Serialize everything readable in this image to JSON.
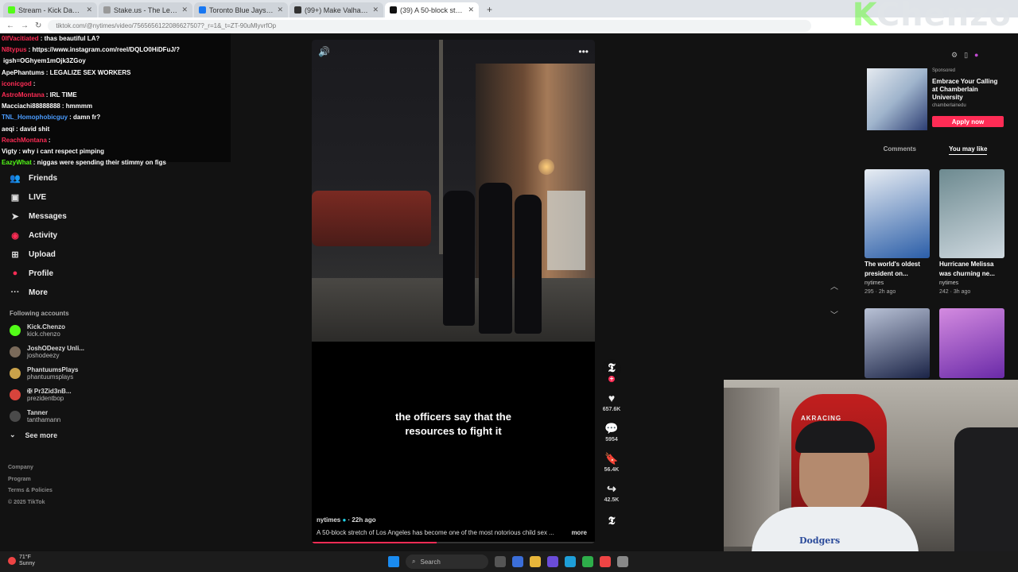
{
  "browser": {
    "tabs": [
      {
        "label": "Stream - Kick Dashboard",
        "fav_color": "#53fc18"
      },
      {
        "label": "Stake.us - The Leading Social C",
        "fav_color": "#999999"
      },
      {
        "label": "Toronto Blue Jays at Los Angeles",
        "fav_color": "#1877f2"
      },
      {
        "label": "(99+) Make Valhalla Great Again",
        "fav_color": "#333333"
      },
      {
        "label": "(39) A 50-block stretch of",
        "fav_color": "#111111",
        "active": true
      }
    ],
    "new_tab": "+",
    "url": "tiktok.com/@nytimes/video/7565656122086627507?_r=1&_t=ZT-90uMlyvrfOp",
    "logo_k": "K",
    "logo_text": "Chenzo"
  },
  "chat": [
    {
      "user": "0lfVacitiated",
      "color": "#fe2c55",
      "text": ": thas beautiful LA?"
    },
    {
      "user": "N8typus",
      "color": "#fe2c55",
      "text": ": https://www.instagram.com/reel/DQLO0HiDFuJ/?"
    },
    {
      "user": "",
      "color": "#ffffff",
      "text": "igsh=OGhyem1mOjk3ZGoy"
    },
    {
      "user": "ApePhantums",
      "color": "#ffffff",
      "text": ": LEGALIZE SEX WORKERS"
    },
    {
      "user": "iconicgod",
      "color": "#fe2c55",
      "text": ":"
    },
    {
      "user": "AstroMontana",
      "color": "#fe2c55",
      "text": ": IRL TIME"
    },
    {
      "user": "Macciachi88888888",
      "color": "#ffffff",
      "text": ": hmmmm"
    },
    {
      "user": "TNL_Homophobicguy",
      "color": "#4a9cff",
      "text": ": damn fr?"
    },
    {
      "user": "aeqi",
      "color": "#ffffff",
      "text": ": david shit"
    },
    {
      "user": "ReachMontana",
      "color": "#fe2c55",
      "text": ":"
    },
    {
      "user": "Vigty",
      "color": "#ffffff",
      "text": ": why i cant respect pimping"
    },
    {
      "user": "EazyWhat",
      "color": "#53fc18",
      "text": ": niggas were spending their stimmy on figs"
    }
  ],
  "sidebar": {
    "items": [
      {
        "label": "Friends",
        "icon": "users-icon",
        "glyph": "👥"
      },
      {
        "label": "LIVE",
        "icon": "live-icon",
        "glyph": "▣"
      },
      {
        "label": "Messages",
        "icon": "messages-icon",
        "glyph": "➤"
      },
      {
        "label": "Activity",
        "icon": "activity-icon",
        "glyph": "◉"
      },
      {
        "label": "Upload",
        "icon": "upload-icon",
        "glyph": "⊞"
      },
      {
        "label": "Profile",
        "icon": "profile-icon",
        "glyph": "●"
      },
      {
        "label": "More",
        "icon": "more-icon",
        "glyph": "···"
      }
    ],
    "following_title": "Following accounts",
    "accounts": [
      {
        "name": "Kick.Chenzo",
        "handle": "kick.chenzo"
      },
      {
        "name": "JoshODeezy Unli...",
        "handle": "joshodeezy"
      },
      {
        "name": "PhantuumsPlays",
        "handle": "phantuumsplays"
      },
      {
        "name": "✠ Pr3Zid3nB...",
        "handle": "prezidentbop"
      },
      {
        "name": "Tanner",
        "handle": "tanthamann"
      }
    ],
    "see_more": "See more",
    "footer": [
      "Company",
      "Program",
      "Terms & Policies",
      "© 2025 TikTok"
    ]
  },
  "video": {
    "caption": "the officers say that the resources to fight it",
    "author": "nytimes",
    "time": "22h ago",
    "description": "A 50-block stretch of Los Angeles has become one of the most notorious child sex ...",
    "more": "more",
    "progress": 0.44,
    "volume_glyph": "🔊",
    "menu_glyph": "•••"
  },
  "actions": {
    "avatar_glyph": "𝕿",
    "likes": "657.6K",
    "comments": "5954",
    "saves": "56.4K",
    "shares": "42.5K"
  },
  "right": {
    "sponsored": "Sponsored",
    "ad_title": "Embrace Your Calling at Chamberlain University",
    "ad_source": "chamberlainedu",
    "ad_button": "Apply now",
    "tabs": [
      "Comments",
      "You may like"
    ],
    "cards": [
      {
        "title": "The world's oldest president on...",
        "author": "nytimes",
        "stats": "295 · 2h ago",
        "colors": [
          "#2b5ea8",
          "#e8edf3"
        ]
      },
      {
        "title": "Hurricane Melissa was churning ne...",
        "author": "nytimes",
        "stats": "242 · 3h ago",
        "colors": [
          "#cfd9e0",
          "#6d8a90"
        ]
      },
      {
        "title": "",
        "author": "",
        "stats": "",
        "colors": [
          "#1b2447",
          "#b9c2d6"
        ]
      },
      {
        "title": "",
        "author": "",
        "stats": "",
        "colors": [
          "#6a2aa8",
          "#d48be0"
        ]
      }
    ]
  },
  "webcam": {
    "chair_text": "AKRACING",
    "shirt_text": "Dodgers"
  },
  "taskbar": {
    "temp": "71°F",
    "weather": "Sunny",
    "search_placeholder": "Search"
  }
}
